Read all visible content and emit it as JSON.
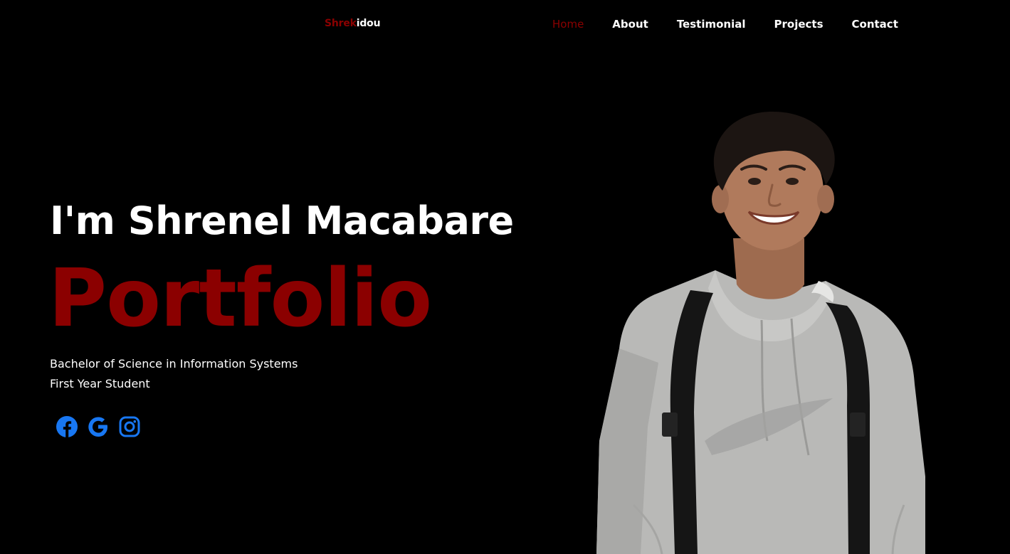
{
  "brand": {
    "part1": "Shrek",
    "part2": "idou"
  },
  "nav": {
    "home": "Home",
    "about": "About",
    "testimonial": "Testimonial",
    "projects": "Projects",
    "contact": "Contact"
  },
  "hero": {
    "greeting": "I'm Shrenel Macabare",
    "title": "Portfolio",
    "line1": "Bachelor of Science in Information Systems",
    "line2": "First Year Student"
  },
  "socials": [
    {
      "icon": "facebook-icon"
    },
    {
      "icon": "google-icon"
    },
    {
      "icon": "instagram-icon"
    }
  ],
  "colors": {
    "background": "#000000",
    "accent": "#8b0000",
    "text": "#ffffff",
    "social": "#1877f2",
    "hoodie": "#b9b9b7",
    "skin": "#b07a5c",
    "hair": "#1c1512",
    "strap": "#151515"
  }
}
